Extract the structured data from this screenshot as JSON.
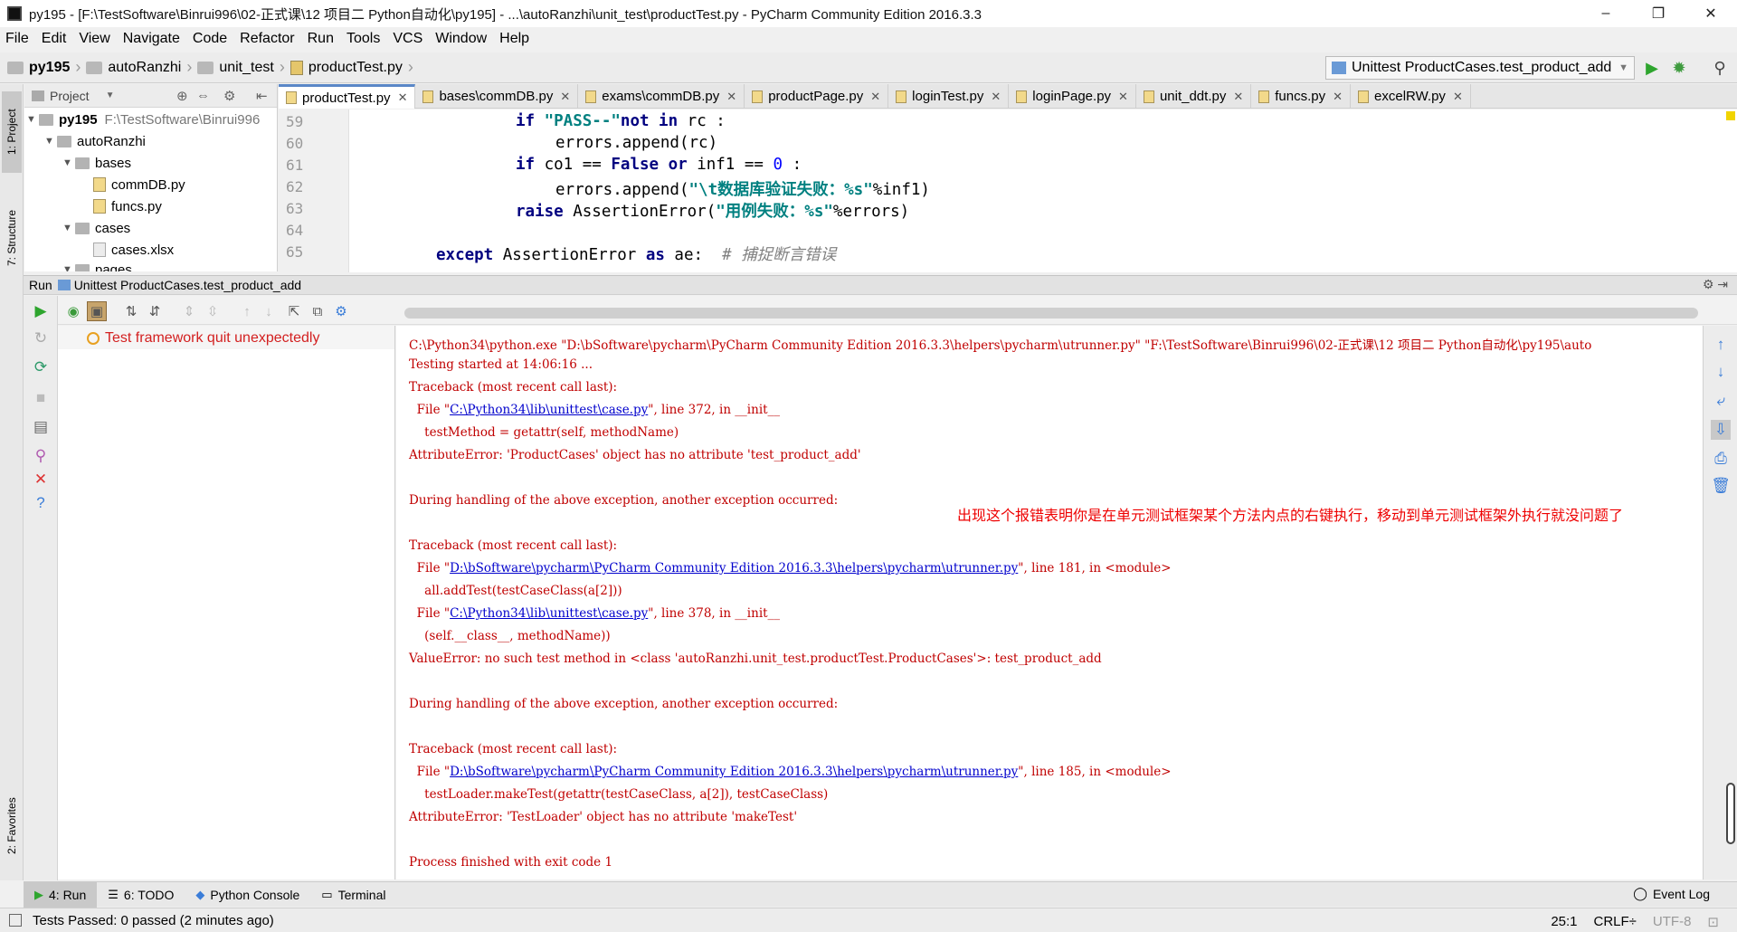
{
  "window": {
    "title": "py195 - [F:\\TestSoftware\\Binrui996\\02-正式课\\12 项目二 Python自动化\\py195] - ...\\autoRanzhi\\unit_test\\productTest.py - PyCharm Community Edition 2016.3.3",
    "minimize": "–",
    "restore": "❐",
    "close": "✕"
  },
  "menu": [
    "File",
    "Edit",
    "View",
    "Navigate",
    "Code",
    "Refactor",
    "Run",
    "Tools",
    "VCS",
    "Window",
    "Help"
  ],
  "breadcrumbs": [
    "py195",
    "autoRanzhi",
    "unit_test",
    "productTest.py"
  ],
  "run_config": "Unittest ProductCases.test_product_add",
  "left_strip": {
    "project_tab": "1: Project",
    "structure_tab": "7: Structure",
    "favorites_tab": "2: Favorites"
  },
  "project_panel": {
    "header": "Project",
    "tree": [
      {
        "label": "py195",
        "path": "F:\\TestSoftware\\Binrui996"
      },
      {
        "label": "autoRanzhi"
      },
      {
        "label": "bases"
      },
      {
        "label": "commDB.py"
      },
      {
        "label": "funcs.py"
      },
      {
        "label": "cases"
      },
      {
        "label": "cases.xlsx"
      },
      {
        "label": "pages"
      }
    ]
  },
  "editor_tabs": [
    "productTest.py",
    "bases\\commDB.py",
    "exams\\commDB.py",
    "productPage.py",
    "loginTest.py",
    "loginPage.py",
    "unit_ddt.py",
    "funcs.py",
    "excelRW.py"
  ],
  "editor": {
    "line_numbers": [
      "59",
      "60",
      "61",
      "62",
      "63",
      "64",
      "65"
    ]
  },
  "run_panel": {
    "header_prefix": "Run",
    "header_title": "Unittest ProductCases.test_product_add",
    "test_status": "Test framework quit unexpectedly"
  },
  "console": {
    "line1": "C:\\Python34\\python.exe \"D:\\bSoftware\\pycharm\\PyCharm Community Edition 2016.3.3\\helpers\\pycharm\\utrunner.py\" \"F:\\TestSoftware\\Binrui996\\02-正式课\\12 项目二 Python自动化\\py195\\auto",
    "line2": "Testing started at 14:06:16 ...",
    "tb1": "Traceback (most recent call last):",
    "f1_pre": "  File \"",
    "f1_link": "C:\\Python34\\lib\\unittest\\case.py",
    "f1_post": "\", line 372, in __init__",
    "f1_code": "    testMethod = getattr(self, methodName)",
    "err1": "AttributeError: 'ProductCases' object has no attribute 'test_product_add'",
    "during1": "During handling of the above exception, another exception occurred:",
    "tb2": "Traceback (most recent call last):",
    "f2_pre": "  File \"",
    "f2_link": "D:\\bSoftware\\pycharm\\PyCharm Community Edition 2016.3.3\\helpers\\pycharm\\utrunner.py",
    "f2_post": "\", line 181, in <module>",
    "f2_code": "    all.addTest(testCaseClass(a[2]))",
    "f3_pre": "  File \"",
    "f3_link": "C:\\Python34\\lib\\unittest\\case.py",
    "f3_post": "\", line 378, in __init__",
    "f3_code": "    (self.__class__, methodName))",
    "err2": "ValueError: no such test method in <class 'autoRanzhi.unit_test.productTest.ProductCases'>: test_product_add",
    "during2": "During handling of the above exception, another exception occurred:",
    "tb3": "Traceback (most recent call last):",
    "f4_pre": "  File \"",
    "f4_link": "D:\\bSoftware\\pycharm\\PyCharm Community Edition 2016.3.3\\helpers\\pycharm\\utrunner.py",
    "f4_post": "\", line 185, in <module>",
    "f4_code": "    testLoader.makeTest(getattr(testCaseClass, a[2]), testCaseClass)",
    "err3": "AttributeError: 'TestLoader' object has no attribute 'makeTest'",
    "finished": "Process finished with exit code 1",
    "annotation": "出现这个报错表明你是在单元测试框架某个方法内点的右键执行，移动到单元测试框架外执行就没问题了"
  },
  "bottom_tabs": {
    "run": "4: Run",
    "todo": "6: TODO",
    "python_console": "Python Console",
    "terminal": "Terminal",
    "event_log": "Event Log"
  },
  "status": {
    "message": "Tests Passed: 0 passed (2 minutes ago)",
    "position": "25:1",
    "line_sep": "CRLF÷",
    "encoding": "UTF-8"
  },
  "colors": {
    "accent": "#5a87c7",
    "error_text": "#c00000",
    "annotation": "#ee0000",
    "link": "#0000cc",
    "keyword": "#000080",
    "string": "#008080"
  }
}
